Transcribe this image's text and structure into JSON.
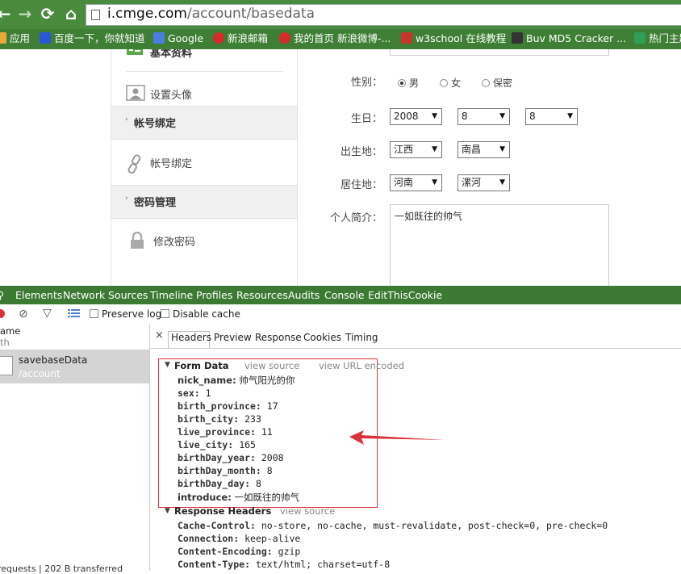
{
  "browser": {
    "url_host": "i.cmge.com",
    "url_path": "/account/basedata",
    "bookmarks": [
      {
        "label": "应用",
        "icon": "apps-icon",
        "color": "#e84b3c"
      },
      {
        "label": "百度一下，你就知道",
        "icon": "baidu-icon",
        "color": "#2a57d6"
      },
      {
        "label": "Google",
        "icon": "google-icon",
        "color": "#4a7fe0"
      },
      {
        "label": "新浪邮箱",
        "icon": "weibo-icon",
        "color": "#d42b2b"
      },
      {
        "label": "我的首页 新浪微博-...",
        "icon": "weibo-icon",
        "color": "#d42b2b"
      },
      {
        "label": "w3school 在线教程",
        "icon": "w3school-icon",
        "color": "#c9352b"
      },
      {
        "label": "Buv MD5 Cracker ...",
        "icon": "md5-icon",
        "color": "#333333"
      },
      {
        "label": "热门主题",
        "icon": "topic-icon",
        "color": "#2f9e56"
      }
    ]
  },
  "sidebar": {
    "section_top_partial": "基本资料",
    "item_avatar": "设置头像",
    "section_account": "帐号绑定",
    "item_bind": "帐号绑定",
    "section_password": "密码管理",
    "item_change_pw": "修改密码"
  },
  "form": {
    "gender_label": "性别：",
    "gender_options": [
      "男",
      "女",
      "保密"
    ],
    "gender_selected": "男",
    "birthday_label": "生日：",
    "birth_year": "2008",
    "birth_month": "8",
    "birth_day": "8",
    "birthplace_label": "出生地：",
    "birth_province": "江西",
    "birth_city": "南昌",
    "residence_label": "居住地：",
    "live_province": "河南",
    "live_city": "漯河",
    "bio_label": "个人简介：",
    "bio_value": "一如既往的帅气"
  },
  "devtools": {
    "tabs": [
      "Elements",
      "Network",
      "Sources",
      "Timeline",
      "Profiles",
      "Resources",
      "Audits",
      "Console",
      "EditThisCookie"
    ],
    "preserve_log": "Preserve log",
    "disable_cache": "Disable cache",
    "col_name": "ame",
    "col_path": "th",
    "request_name": "savebaseData",
    "request_path": "/account",
    "status_bar": "requests | 202 B transferred",
    "sub_tabs": [
      "Headers",
      "Preview",
      "Response",
      "Cookies",
      "Timing"
    ],
    "form_data_title": "Form Data",
    "view_source": "view source",
    "view_url_encoded": "view URL encoded",
    "form_data": [
      {
        "key": "nick_name:",
        "value": "帅气阳光的你"
      },
      {
        "key": "sex:",
        "value": "1"
      },
      {
        "key": "birth_province:",
        "value": "17"
      },
      {
        "key": "birth_city:",
        "value": "233"
      },
      {
        "key": "live_province:",
        "value": "11"
      },
      {
        "key": "live_city:",
        "value": "165"
      },
      {
        "key": "birthDay_year:",
        "value": "2008"
      },
      {
        "key": "birthDay_month:",
        "value": "8"
      },
      {
        "key": "birthDay_day:",
        "value": "8"
      },
      {
        "key": "introduce:",
        "value": "一如既往的帅气"
      }
    ],
    "response_headers_title": "Response Headers",
    "response_headers_view_source": "view source",
    "response_headers": [
      {
        "key": "Cache-Control:",
        "value": "no-store, no-cache, must-revalidate, post-check=0, pre-check=0"
      },
      {
        "key": "Connection:",
        "value": "keep-alive"
      },
      {
        "key": "Content-Encoding:",
        "value": "gzip"
      },
      {
        "key": "Content-Type:",
        "value": "text/html; charset=utf-8"
      }
    ],
    "highlight_color": "#d9333a"
  }
}
